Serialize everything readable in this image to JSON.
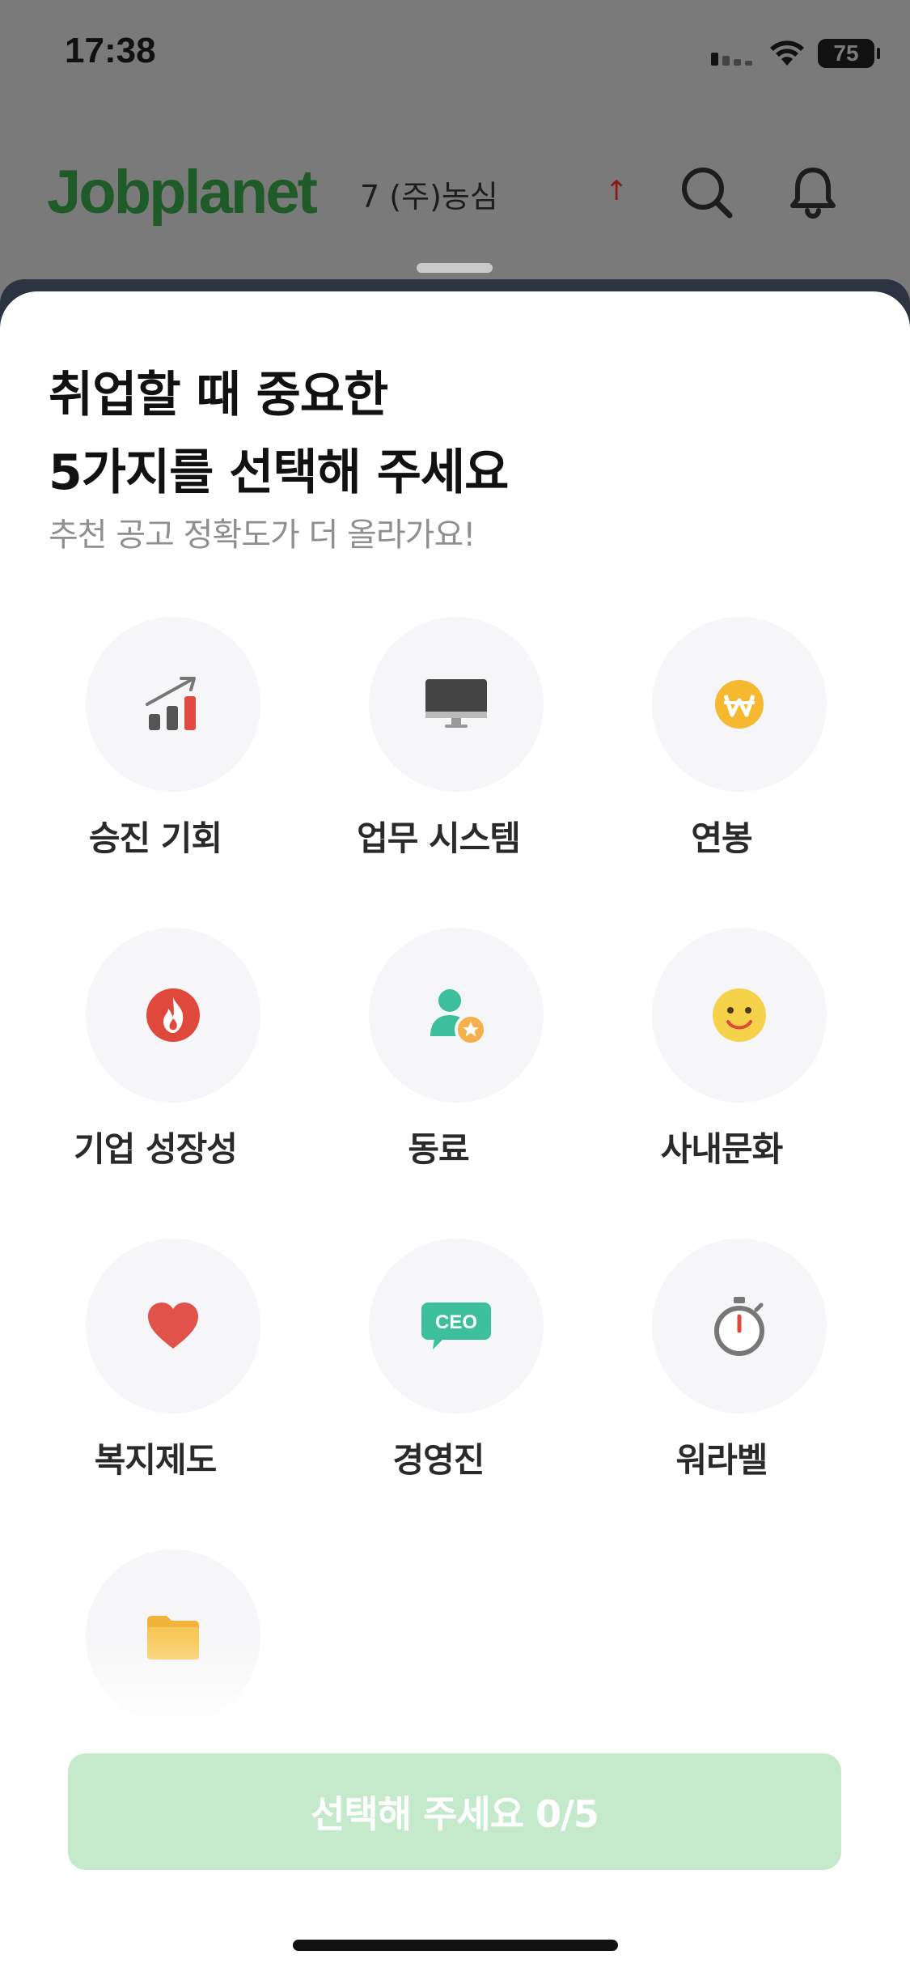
{
  "status_bar": {
    "time": "17:38",
    "battery": "75"
  },
  "background_app": {
    "logo": "Jobplanet",
    "ticker_rank": "7",
    "ticker_company": "(주)농심",
    "ticker_trend": "↑"
  },
  "sheet": {
    "title_line1": "취업할 때 중요한",
    "title_line2": "5가지를 선택해 주세요",
    "subtitle": "추천 공고 정확도가 더 올라가요!",
    "options": [
      {
        "label": "승진 기회",
        "icon": "growth-chart-icon"
      },
      {
        "label": "업무 시스템",
        "icon": "monitor-icon"
      },
      {
        "label": "연봉",
        "icon": "won-coin-icon"
      },
      {
        "label": "기업 성장성",
        "icon": "flame-icon"
      },
      {
        "label": "동료",
        "icon": "colleague-star-icon"
      },
      {
        "label": "사내문화",
        "icon": "smile-icon"
      },
      {
        "label": "복지제도",
        "icon": "heart-icon"
      },
      {
        "label": "경영진",
        "icon": "ceo-badge-icon"
      },
      {
        "label": "워라벨",
        "icon": "stopwatch-icon"
      },
      {
        "label": "",
        "icon": "folder-icon"
      }
    ],
    "cta_label": "선택해 주세요 0/5"
  },
  "colors": {
    "accent_green": "#1f5a29",
    "cta_disabled": "#c5eacb"
  }
}
